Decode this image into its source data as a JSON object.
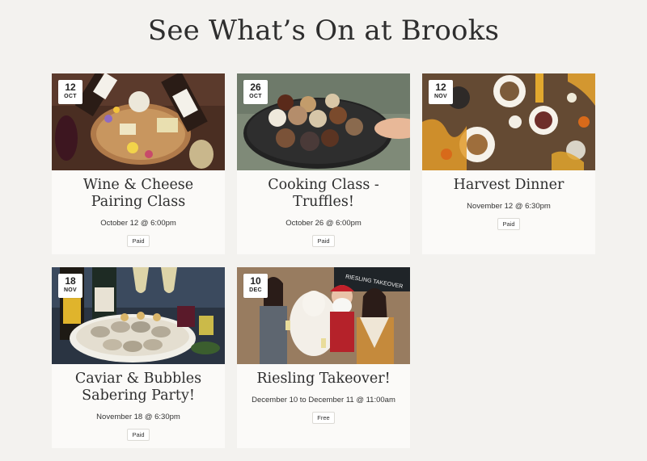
{
  "page": {
    "title": "See What’s On at Brooks"
  },
  "events": [
    {
      "day": "12",
      "month": "OCT",
      "title": "Wine & Cheese Pairing Class",
      "when": "October 12 @ 6:00pm",
      "price": "Paid"
    },
    {
      "day": "26",
      "month": "OCT",
      "title": "Cooking Class - Truffles!",
      "when": "October 26 @ 6:00pm",
      "price": "Paid"
    },
    {
      "day": "12",
      "month": "NOV",
      "title": "Harvest Dinner",
      "when": "November 12 @ 6:30pm",
      "price": "Paid"
    },
    {
      "day": "18",
      "month": "NOV",
      "title": "Caviar & Bubbles Sabering Party!",
      "when": "November 18 @ 6:30pm",
      "price": "Paid"
    },
    {
      "day": "10",
      "month": "DEC",
      "title": "Riesling Takeover!",
      "when": "December 10 to December 11 @ 11:00am",
      "price": "Free"
    }
  ],
  "photo_text": {
    "banner": "RIESLING TAKEOVER"
  }
}
